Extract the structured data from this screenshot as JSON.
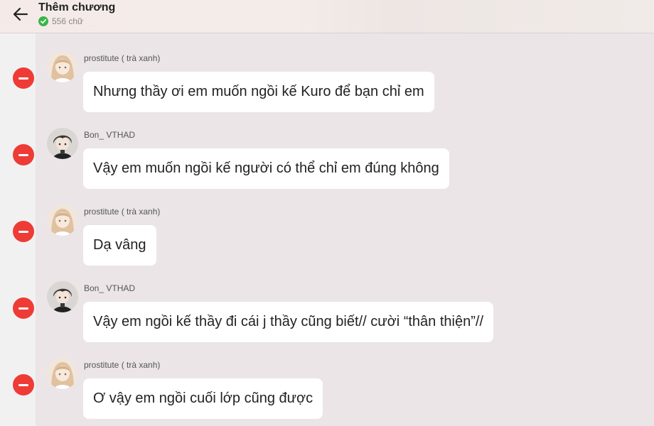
{
  "header": {
    "title": "Thêm chương",
    "word_count": "556 chữ"
  },
  "messages": [
    {
      "sender": "prostitute ( trà xanh)",
      "avatar": "girl-avatar",
      "text": "Nhưng thầy ơi em muốn ngồi kế Kuro để bạn chỉ em"
    },
    {
      "sender": "Bon_ VTHAD",
      "avatar": "boy-avatar",
      "text": "Vậy em muốn ngồi kế người có thể chỉ em đúng không"
    },
    {
      "sender": "prostitute ( trà xanh)",
      "avatar": "girl-avatar",
      "text": "Dạ vâng"
    },
    {
      "sender": "Bon_ VTHAD",
      "avatar": "boy-avatar",
      "text": "Vậy em ngồi kế thầy đi cái j thầy cũng biết// cười “thân thiện”//"
    },
    {
      "sender": "prostitute ( trà xanh)",
      "avatar": "girl-avatar",
      "text": "Ơ vậy em ngồi cuối lớp cũng được"
    }
  ],
  "colors": {
    "remove": "#ee3b36",
    "check": "#39b54a",
    "background": "#ebe5e7"
  }
}
